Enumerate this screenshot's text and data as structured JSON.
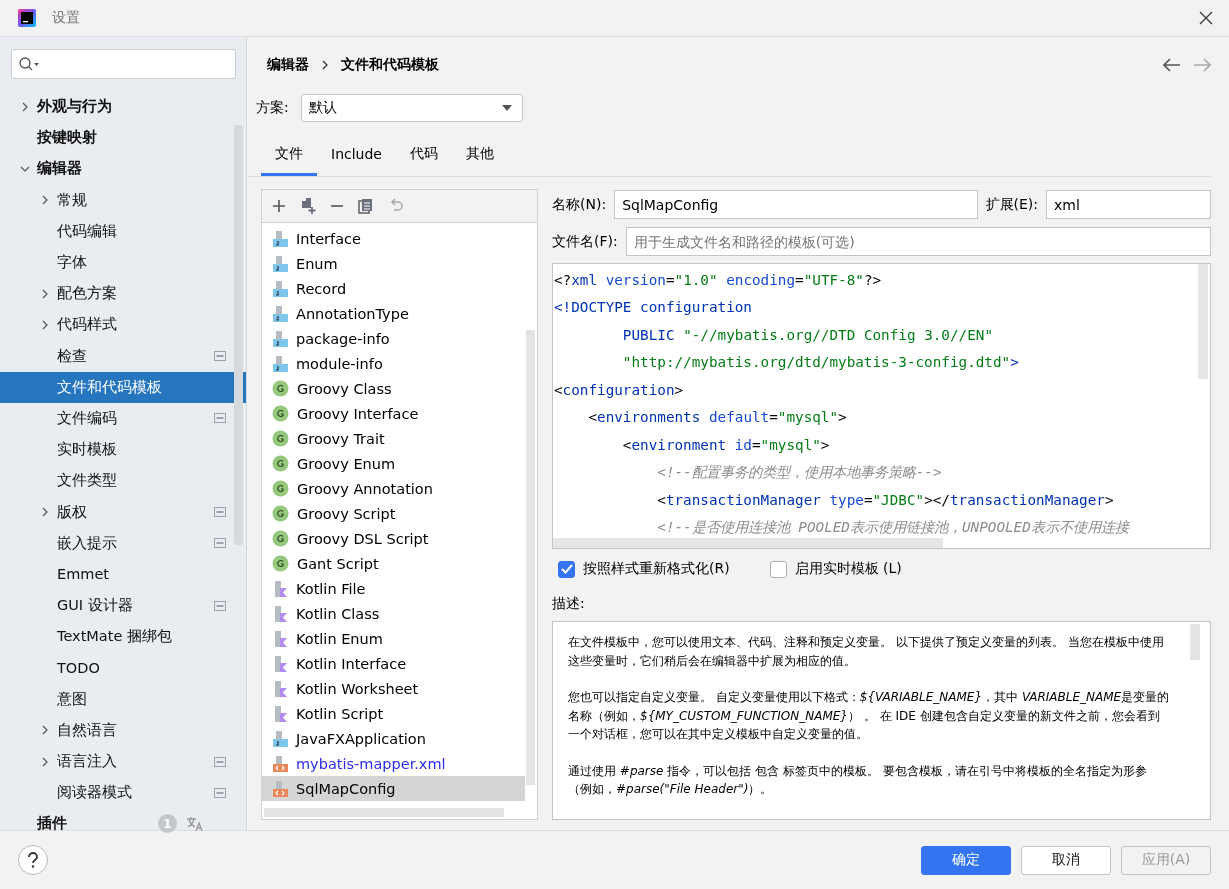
{
  "window": {
    "title": "设置"
  },
  "sidebar": {
    "items": [
      {
        "label": "外观与行为",
        "expandable": true,
        "expanded": false,
        "selected": false,
        "badge": false
      },
      {
        "label": "按键映射",
        "expandable": false,
        "selected": false,
        "badge": false
      },
      {
        "label": "编辑器",
        "expandable": true,
        "expanded": true,
        "selected": false,
        "badge": false,
        "children": [
          {
            "label": "常规",
            "expandable": true,
            "expanded": false,
            "selected": false,
            "badge": false
          },
          {
            "label": "代码编辑",
            "expandable": false,
            "selected": false,
            "badge": false
          },
          {
            "label": "字体",
            "expandable": false,
            "selected": false,
            "badge": false
          },
          {
            "label": "配色方案",
            "expandable": true,
            "expanded": false,
            "selected": false,
            "badge": false
          },
          {
            "label": "代码样式",
            "expandable": true,
            "expanded": false,
            "selected": false,
            "badge": false
          },
          {
            "label": "检查",
            "expandable": false,
            "selected": false,
            "badge": true
          },
          {
            "label": "文件和代码模板",
            "expandable": false,
            "selected": true,
            "badge": false
          },
          {
            "label": "文件编码",
            "expandable": false,
            "selected": false,
            "badge": true
          },
          {
            "label": "实时模板",
            "expandable": false,
            "selected": false,
            "badge": false
          },
          {
            "label": "文件类型",
            "expandable": false,
            "selected": false,
            "badge": false
          },
          {
            "label": "版权",
            "expandable": true,
            "expanded": false,
            "selected": false,
            "badge": true
          },
          {
            "label": "嵌入提示",
            "expandable": false,
            "selected": false,
            "badge": true
          },
          {
            "label": "Emmet",
            "expandable": false,
            "selected": false,
            "badge": false
          },
          {
            "label": "GUI 设计器",
            "expandable": false,
            "selected": false,
            "badge": true
          },
          {
            "label": "TextMate 捆绑包",
            "expandable": false,
            "selected": false,
            "badge": false
          },
          {
            "label": "TODO",
            "expandable": false,
            "selected": false,
            "badge": false
          },
          {
            "label": "意图",
            "expandable": false,
            "selected": false,
            "badge": false
          },
          {
            "label": "自然语言",
            "expandable": true,
            "expanded": false,
            "selected": false,
            "badge": false
          },
          {
            "label": "语言注入",
            "expandable": true,
            "expanded": false,
            "selected": false,
            "badge": true
          },
          {
            "label": "阅读器模式",
            "expandable": false,
            "selected": false,
            "badge": true
          }
        ]
      },
      {
        "label": "插件",
        "expandable": false,
        "selected": false,
        "badge": false,
        "count": "1"
      }
    ]
  },
  "breadcrumb": [
    "编辑器",
    "文件和代码模板"
  ],
  "scheme": {
    "label": "方案:",
    "value": "默认"
  },
  "tabs": [
    {
      "label": "文件",
      "selected": true
    },
    {
      "label": "Include",
      "selected": false
    },
    {
      "label": "代码",
      "selected": false
    },
    {
      "label": "其他",
      "selected": false
    }
  ],
  "templates": [
    {
      "name": "Interface",
      "kind": "java",
      "selected": false,
      "changed": false
    },
    {
      "name": "Enum",
      "kind": "java",
      "selected": false,
      "changed": false
    },
    {
      "name": "Record",
      "kind": "java",
      "selected": false,
      "changed": false
    },
    {
      "name": "AnnotationType",
      "kind": "java",
      "selected": false,
      "changed": false
    },
    {
      "name": "package-info",
      "kind": "java",
      "selected": false,
      "changed": false
    },
    {
      "name": "module-info",
      "kind": "java",
      "selected": false,
      "changed": false
    },
    {
      "name": "Groovy Class",
      "kind": "groovy",
      "selected": false,
      "changed": false
    },
    {
      "name": "Groovy Interface",
      "kind": "groovy",
      "selected": false,
      "changed": false
    },
    {
      "name": "Groovy Trait",
      "kind": "groovy",
      "selected": false,
      "changed": false
    },
    {
      "name": "Groovy Enum",
      "kind": "groovy",
      "selected": false,
      "changed": false
    },
    {
      "name": "Groovy Annotation",
      "kind": "groovy",
      "selected": false,
      "changed": false
    },
    {
      "name": "Groovy Script",
      "kind": "groovy",
      "selected": false,
      "changed": false
    },
    {
      "name": "Groovy DSL Script",
      "kind": "groovy",
      "selected": false,
      "changed": false
    },
    {
      "name": "Gant Script",
      "kind": "groovy",
      "selected": false,
      "changed": false
    },
    {
      "name": "Kotlin File",
      "kind": "kotlin",
      "selected": false,
      "changed": false
    },
    {
      "name": "Kotlin Class",
      "kind": "kotlin",
      "selected": false,
      "changed": false
    },
    {
      "name": "Kotlin Enum",
      "kind": "kotlin",
      "selected": false,
      "changed": false
    },
    {
      "name": "Kotlin Interface",
      "kind": "kotlin",
      "selected": false,
      "changed": false
    },
    {
      "name": "Kotlin Worksheet",
      "kind": "kotlin",
      "selected": false,
      "changed": false
    },
    {
      "name": "Kotlin Script",
      "kind": "kotlin",
      "selected": false,
      "changed": false
    },
    {
      "name": "JavaFXApplication",
      "kind": "java",
      "selected": false,
      "changed": false
    },
    {
      "name": "mybatis-mapper.xml",
      "kind": "xml",
      "selected": false,
      "changed": true
    },
    {
      "name": "SqlMapConfig",
      "kind": "xml",
      "selected": true,
      "changed": false
    }
  ],
  "name_field": {
    "label": "名称(N):",
    "value": "SqlMapConfig"
  },
  "ext_field": {
    "label": "扩展(E):",
    "value": "xml"
  },
  "filename_field": {
    "label": "文件名(F):",
    "placeholder": "用于生成文件名和路径的模板(可选)"
  },
  "code_lines": [
    [
      {
        "t": "<?",
        "kind": "plain"
      },
      {
        "t": "xml ",
        "kind": "tag"
      },
      {
        "t": "version",
        "kind": "attr"
      },
      {
        "t": "=",
        "kind": "plain"
      },
      {
        "t": "\"1.0\" ",
        "kind": "value"
      },
      {
        "t": "encoding",
        "kind": "attr"
      },
      {
        "t": "=",
        "kind": "plain"
      },
      {
        "t": "\"UTF-8\"",
        "kind": "value"
      },
      {
        "t": "?>",
        "kind": "plain"
      }
    ],
    [
      {
        "t": "<!DOCTYPE configuration",
        "kind": "tag"
      }
    ],
    [
      {
        "t": "        PUBLIC ",
        "kind": "tag"
      },
      {
        "t": "\"-//mybatis.org//DTD Config 3.0//EN\"",
        "kind": "value"
      }
    ],
    [
      {
        "t": "        \"http://mybatis.org/dtd/mybatis-3-config.dtd\"",
        "kind": "value"
      },
      {
        "t": ">",
        "kind": "tag"
      }
    ],
    [
      {
        "t": "<",
        "kind": "plain"
      },
      {
        "t": "configuration",
        "kind": "tag"
      },
      {
        "t": ">",
        "kind": "plain"
      }
    ],
    [
      {
        "t": "    <",
        "kind": "plain"
      },
      {
        "t": "environments ",
        "kind": "tag"
      },
      {
        "t": "default",
        "kind": "attr"
      },
      {
        "t": "=",
        "kind": "plain"
      },
      {
        "t": "\"mysql\"",
        "kind": "value"
      },
      {
        "t": ">",
        "kind": "plain"
      }
    ],
    [
      {
        "t": "        <",
        "kind": "plain"
      },
      {
        "t": "environment ",
        "kind": "tag"
      },
      {
        "t": "id",
        "kind": "attr"
      },
      {
        "t": "=",
        "kind": "plain"
      },
      {
        "t": "\"mysql\"",
        "kind": "value"
      },
      {
        "t": ">",
        "kind": "plain"
      }
    ],
    [
      {
        "t": "            <!--配置事务的类型，使用本地事务策略-->",
        "kind": "comment"
      }
    ],
    [
      {
        "t": "            <",
        "kind": "plain"
      },
      {
        "t": "transactionManager ",
        "kind": "tag"
      },
      {
        "t": "type",
        "kind": "attr"
      },
      {
        "t": "=",
        "kind": "plain"
      },
      {
        "t": "\"JDBC\"",
        "kind": "value"
      },
      {
        "t": "></",
        "kind": "plain"
      },
      {
        "t": "transactionManager",
        "kind": "tag"
      },
      {
        "t": ">",
        "kind": "plain"
      }
    ],
    [
      {
        "t": "            <!--是否使用连接池 POOLED表示使用链接池，UNPOOLED表示不使用连接",
        "kind": "comment"
      }
    ]
  ],
  "options": [
    {
      "label": "按照样式重新格式化(R)",
      "checked": true
    },
    {
      "label": "启用实时模板 (L)",
      "checked": false
    }
  ],
  "description": {
    "label": "描述:",
    "paragraphs": [
      [
        {
          "t": "在文件模板中，您可以使用文本、代码、注释和预定义变量。 以下提供了预定义变量的列表。 当您在模板中使用这些变量时，它们稍后会在编辑器中扩展为相应的值。",
          "italic": false
        }
      ],
      [
        {
          "t": "您也可以指定自定义变量。 自定义变量使用以下格式：",
          "italic": false
        },
        {
          "t": "${VARIABLE_NAME}",
          "italic": true
        },
        {
          "t": "，其中 ",
          "italic": false
        },
        {
          "t": "VARIABLE_NAME",
          "italic": true
        },
        {
          "t": "是变量的名称（例如，",
          "italic": false
        },
        {
          "t": "${MY_CUSTOM_FUNCTION_NAME}",
          "italic": true
        },
        {
          "t": "） 。 在 IDE 创建包含自定义变量的新文件之前，您会看到一个对话框，您可以在其中定义模板中自定义变量的值。",
          "italic": false
        }
      ],
      [
        {
          "t": "通过使用 ",
          "italic": false
        },
        {
          "t": "#parse",
          "italic": true
        },
        {
          "t": " 指令，可以包括 包含 标签页中的模板。 要包含模板，请在引号中将模板的全名指定为形参（例如，",
          "italic": false
        },
        {
          "t": "#parse(\"File Header\")",
          "italic": true
        },
        {
          "t": "）。",
          "italic": false
        }
      ]
    ]
  },
  "buttons": [
    {
      "label": "确定",
      "kind": "primary",
      "disabled": false
    },
    {
      "label": "取消",
      "kind": "normal",
      "disabled": false
    },
    {
      "label": "应用(A)",
      "kind": "normal",
      "disabled": true
    }
  ]
}
